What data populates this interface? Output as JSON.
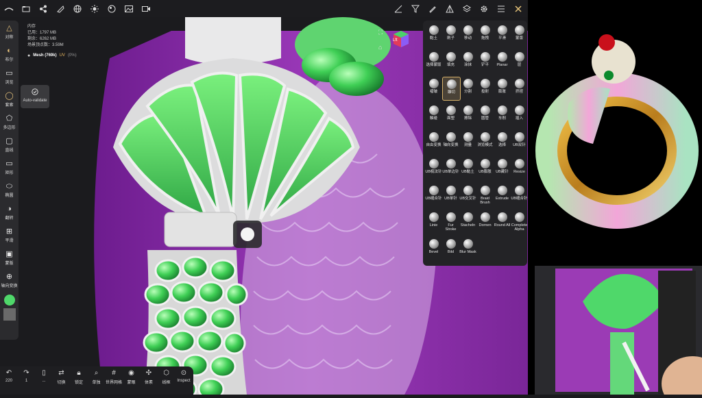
{
  "topbar": {
    "icons": [
      "logo-icon",
      "folder-icon",
      "share-icon",
      "paint-icon",
      "globe-icon",
      "sun-icon",
      "material-icon",
      "image-icon",
      "video-icon"
    ],
    "right_icons": [
      "measure-icon",
      "filter-icon",
      "pen-icon",
      "triangle-icon",
      "layers-icon",
      "settings-icon",
      "menu-icon",
      "close-icon"
    ]
  },
  "stats": {
    "memory_title": "内存",
    "used": "已用：1797 MB",
    "remaining": "剩余：6262 MB",
    "vertices": "场景顶点数：3.59M",
    "mesh": "Mesh (769k)",
    "uv": "UV",
    "percent": "(0%)"
  },
  "tooltip": {
    "label": "Auto-validate"
  },
  "left_tools": [
    {
      "label": "对称",
      "icon": "symmetry-icon"
    },
    {
      "label": "布尔",
      "icon": "boolean-icon"
    },
    {
      "label": "浏览",
      "icon": "camera-icon"
    },
    {
      "label": "套索",
      "icon": "lasso-icon"
    },
    {
      "label": "多边形",
      "icon": "polygon-icon"
    },
    {
      "label": "直线",
      "icon": "line-icon"
    },
    {
      "label": "矩形",
      "icon": "rect-icon"
    },
    {
      "label": "椭圆",
      "icon": "ellipse-icon"
    },
    {
      "label": "翻转",
      "icon": "invert-icon"
    },
    {
      "label": "平滑",
      "icon": "smooth-icon"
    },
    {
      "label": "蒙版",
      "icon": "mask-icon"
    },
    {
      "label": "轴向变换",
      "icon": "gizmo-icon"
    }
  ],
  "brushes": [
    [
      "黏土",
      "刷子",
      "移动",
      "拖拽",
      "平滑",
      "蒙版"
    ],
    [
      "选择蒙版",
      "填充",
      "涂抹",
      "铲平",
      "Planar",
      "层"
    ],
    [
      "褶皱",
      "雕切",
      "分割",
      "投射",
      "膨胀",
      "挤捏"
    ],
    [
      "触碰",
      "面塑",
      "擦除",
      "圆管",
      "车削",
      "插入"
    ],
    [
      "自由变换",
      "轴向变换",
      "测量",
      "浏览模式",
      "选择",
      "UB双针"
    ],
    [
      "UB梳法针",
      "UB单边针",
      "UB黏土",
      "UB膨胀",
      "UB藏针",
      "Resize"
    ],
    [
      "UB缝合针",
      "UB单针",
      "UB交叉针",
      "Braid Brush",
      "Extrude",
      "UB缝合针"
    ],
    [
      "Linie",
      "Fur Stroke",
      "Stacheln",
      "Dornen",
      "Round All",
      "Complete Alpha"
    ],
    [
      "Bevel",
      "Bild",
      "Blur Mask"
    ]
  ],
  "bottom": [
    {
      "num": "220",
      "label": "",
      "icon": "undo-icon"
    },
    {
      "num": "1",
      "label": "",
      "icon": "redo-icon"
    },
    {
      "num": "...",
      "label": "",
      "icon": "phone-icon"
    },
    {
      "num": "",
      "label": "切换",
      "icon": "switch-icon"
    },
    {
      "num": "",
      "label": "锁定",
      "icon": "lock-icon"
    },
    {
      "num": "",
      "label": "单独",
      "icon": "solo-icon"
    },
    {
      "num": "",
      "label": "世界网格",
      "icon": "grid-icon"
    },
    {
      "num": "",
      "label": "蒙眼",
      "icon": "eye-icon"
    },
    {
      "num": "",
      "label": "体素",
      "icon": "voxel-icon"
    },
    {
      "num": "",
      "label": "线框",
      "icon": "wireframe-icon"
    },
    {
      "num": "",
      "label": "Inspect",
      "icon": "inspect-icon"
    }
  ],
  "gizmo": {
    "label": "Lft"
  },
  "colors": {
    "accent": "#d9b36a",
    "mesh_green": "#4fd86a",
    "background_purple": "#8a2aa6"
  }
}
